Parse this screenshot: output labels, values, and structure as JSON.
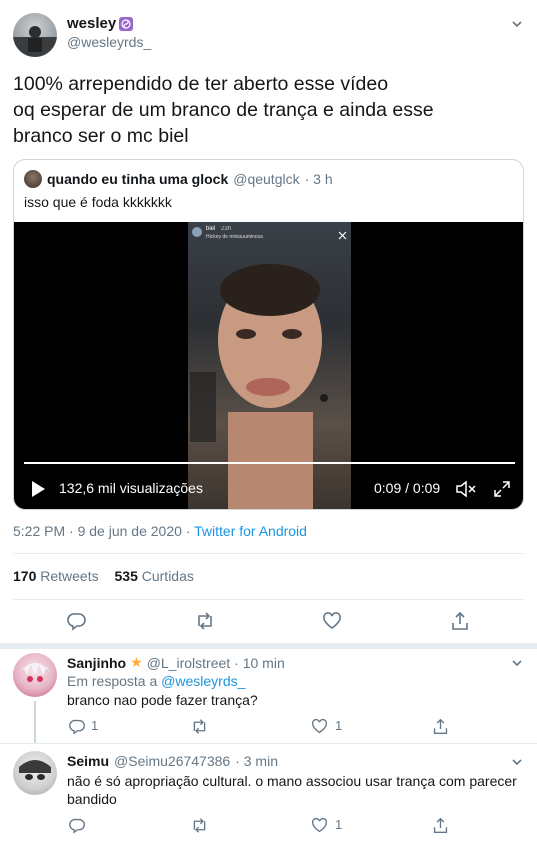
{
  "main_tweet": {
    "display_name": "wesley",
    "handle": "@wesleyrds_",
    "text_lines": [
      "100% arrependido de ter aberto esse vídeo",
      "oq esperar de um branco de trança e ainda esse",
      "branco ser o mc biel"
    ],
    "time": "5:22 PM",
    "date": "9 de jun de 2020",
    "source": "Twitter for Android",
    "sep": "·",
    "retweets_count": "170",
    "retweets_label": "Retweets",
    "likes_count": "535",
    "likes_label": "Curtidas"
  },
  "quoted_tweet": {
    "display_name": "quando eu tinha uma glock",
    "handle": "@qeutglck",
    "time": "· 3 h",
    "text": "isso que é foda kkkkkkk",
    "video": {
      "story_user": "biel",
      "story_time": "23h",
      "story_sub": "Hickey de miniuuuminous",
      "views": "132,6 mil visualizações",
      "time_display": "0:09 / 0:09",
      "progress": 1.0
    }
  },
  "replies": [
    {
      "display_name": "Sanjinho",
      "handle": "@L_irolstreet",
      "time": "· 10 min",
      "reply_prefix": "Em resposta a",
      "reply_to": "@wesleyrds_",
      "text_lines": [
        "branco nao pode fazer trança?"
      ],
      "reply_count": "1",
      "like_count": "1"
    },
    {
      "display_name": "Seimu",
      "handle": "@Seimu26747386",
      "time": "· 3 min",
      "text_lines": [
        "não é só apropriação cultural. o mano associou usar trança com parecer",
        "bandido"
      ],
      "reply_count": "",
      "like_count": "1"
    }
  ],
  "colors": {
    "accent": "#1b95e0",
    "text": "#14171a",
    "muted": "#657786",
    "divider": "#e6ecf0",
    "badge_purple": "#9966cc",
    "star": "#ffac33"
  }
}
